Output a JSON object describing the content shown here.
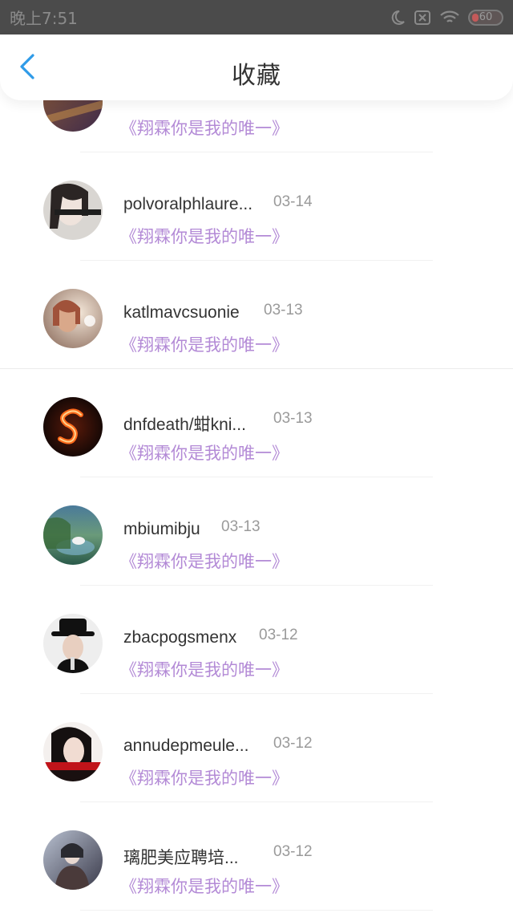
{
  "status_bar": {
    "time": "晚上7:51",
    "battery": "60",
    "icons": [
      "moon-icon",
      "notification-off-icon",
      "wifi-icon",
      "battery-icon"
    ]
  },
  "header": {
    "title": "收藏",
    "back_icon": "chevron-left-icon",
    "accent_color": "#2f9be8"
  },
  "list": {
    "song_color": "#b38ad6",
    "items": [
      {
        "name": "",
        "date": "",
        "song": "《翔霖你是我的唯一》"
      },
      {
        "name": "polvoralphlaure...",
        "date": "03-14",
        "song": "《翔霖你是我的唯一》"
      },
      {
        "name": "katlmavcsuonie",
        "date": "03-13",
        "song": "《翔霖你是我的唯一》"
      },
      {
        "name": "dnfdeath/蚶kni...",
        "date": "03-13",
        "song": "《翔霖你是我的唯一》"
      },
      {
        "name": "mbiumibju",
        "date": "03-13",
        "song": "《翔霖你是我的唯一》"
      },
      {
        "name": "zbacpogsmenx",
        "date": "03-12",
        "song": "《翔霖你是我的唯一》"
      },
      {
        "name": "annudepmeule...",
        "date": "03-12",
        "song": "《翔霖你是我的唯一》"
      },
      {
        "name": "璃肥美应聘培...",
        "date": "03-12",
        "song": "《翔霖你是我的唯一》"
      }
    ]
  }
}
